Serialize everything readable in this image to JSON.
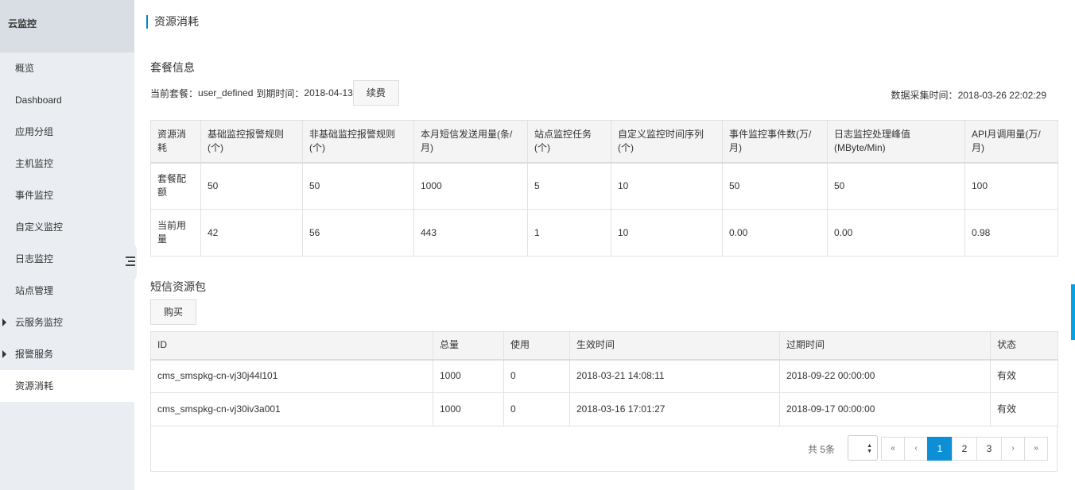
{
  "sidebar": {
    "title": "云监控",
    "items": [
      {
        "label": "概览",
        "expandable": false,
        "active": false
      },
      {
        "label": "Dashboard",
        "expandable": false,
        "active": false
      },
      {
        "label": "应用分组",
        "expandable": false,
        "active": false
      },
      {
        "label": "主机监控",
        "expandable": false,
        "active": false
      },
      {
        "label": "事件监控",
        "expandable": false,
        "active": false
      },
      {
        "label": "自定义监控",
        "expandable": false,
        "active": false
      },
      {
        "label": "日志监控",
        "expandable": false,
        "active": false
      },
      {
        "label": "站点管理",
        "expandable": false,
        "active": false
      },
      {
        "label": "云服务监控",
        "expandable": true,
        "active": false
      },
      {
        "label": "报警服务",
        "expandable": true,
        "active": false
      },
      {
        "label": "资源消耗",
        "expandable": false,
        "active": true
      }
    ]
  },
  "page": {
    "title": "资源消耗",
    "accent_color": "#0088cc"
  },
  "package": {
    "section_title": "套餐信息",
    "current_label": "当前套餐：",
    "current_value": "user_defined",
    "expire_label": "到期时间：",
    "expire_value": "2018-04-13",
    "renew_button": "续费",
    "collect_time_label": "数据采集时间：",
    "collect_time_value": "2018-03-26 22:02:29"
  },
  "quota_table": {
    "headers": [
      "资源消耗",
      "基础监控报警规则(个)",
      "非基础监控报警规则(个)",
      "本月短信发送用量(条/月)",
      "站点监控任务(个)",
      "自定义监控时间序列(个)",
      "事件监控事件数(万/月)",
      "日志监控处理峰值(MByte/Min)",
      "API月调用量(万/月)"
    ],
    "rows": [
      [
        "套餐配额",
        "50",
        "50",
        "1000",
        "5",
        "10",
        "50",
        "50",
        "100"
      ],
      [
        "当前用量",
        "42",
        "56",
        "443",
        "1",
        "10",
        "0.00",
        "0.00",
        "0.98"
      ]
    ]
  },
  "sms": {
    "section_title": "短信资源包",
    "buy_button": "购买",
    "headers": [
      "ID",
      "总量",
      "使用",
      "生效时间",
      "过期时间",
      "状态"
    ],
    "rows": [
      [
        "cms_smspkg-cn-vj30j44l101",
        "1000",
        "0",
        "2018-03-21 14:08:11",
        "2018-09-22 00:00:00",
        "有效"
      ],
      [
        "cms_smspkg-cn-vj30iv3a001",
        "1000",
        "0",
        "2018-03-16 17:01:27",
        "2018-09-17 00:00:00",
        "有效"
      ]
    ]
  },
  "pagination": {
    "total_text": "共 5条",
    "first": "«",
    "prev": "‹",
    "pages": [
      "1",
      "2",
      "3"
    ],
    "active_page": "1",
    "next": "›",
    "last": "»",
    "active_color": "#0d8fd6"
  }
}
